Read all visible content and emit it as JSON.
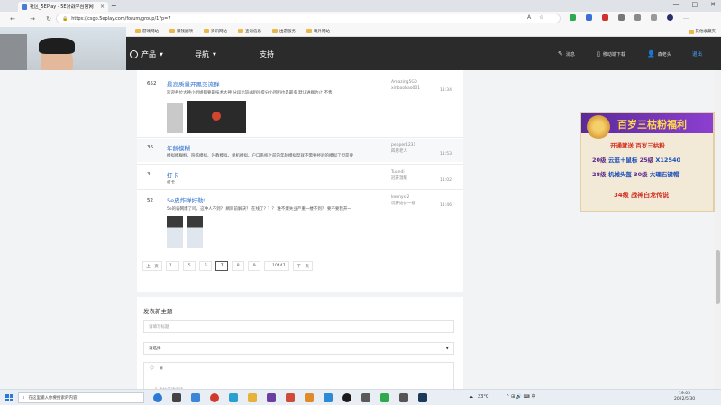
{
  "browser": {
    "tab_title": "社区_5EPlay - 5E对战平台官网",
    "url": "https://csgo.5eplay.com/forum/group/1?p=7",
    "bookmarks": [
      "游戏网站",
      "赚钱副项",
      "资讯网站",
      "查询信息",
      "出游服务",
      "境外网站"
    ],
    "other_bookmarks": "其他收藏夹"
  },
  "site_nav": {
    "products": "产品",
    "nav": "导航",
    "support": "支持",
    "messages": "消息",
    "mobile_download": "移动端下载",
    "username": "森老头",
    "login": "退出"
  },
  "posts": [
    {
      "count": "652",
      "title": "最高质量开黑交流群",
      "subtitle": "欢迎各位大神小姐姐都要最技术大神 分段比较s级别 提分小团团也是最多 默认进群为止 不售",
      "author": "Amazing5G0",
      "author2": "xinbaobao001",
      "time": "11:34"
    },
    {
      "count": "36",
      "title": "年龄模糊",
      "subtitle": "模拟模糊框、陪练模拟、外教模拟、单机模拟、户口系统之前的年龄模拟型就不需要经验的模拟了但是要",
      "author": "pepper1231",
      "author2": "四月老人",
      "time": "11:53"
    },
    {
      "count": "3",
      "title": "打卡",
      "subtitle": "打卡",
      "author": "Tuandi",
      "author2": "冠开温暖",
      "time": "11:02"
    },
    {
      "count": "52",
      "title": "5e皮炸弹好勒!",
      "subtitle": "5e的弱网爆了吗，这种人不到？ 網目前解决？ 在线了？？？ 难不爆失业严重一楼不到？ 要不要我开一",
      "author": "kennys-2",
      "author2": "玩开始价一楼",
      "time": "11:46"
    }
  ],
  "pager": [
    "上一页",
    "1...",
    "5",
    "6",
    "7",
    "8",
    "9",
    "...10447",
    "下一页"
  ],
  "pager_active": "7",
  "new_topic": {
    "title": "发表新主题",
    "title_placeholder": "请填写标题",
    "select_value": "请选择",
    "editor_placeholder": "5 发帖前请阅读"
  },
  "ad": {
    "headline": "百岁三枯粉福利",
    "line1": "开通就送 百岁三枯粉",
    "row1a": "20级",
    "row1b": "云逛＋鼠标",
    "row1c": "25级",
    "row1d": "X12540",
    "row2a": "28级",
    "row2b": "机械头盔",
    "row2c": "30级",
    "row2d": "大理石键帽",
    "row3": "34级 战神白龙传说"
  },
  "taskbar": {
    "search_placeholder": "在这里输入你要搜索的内容",
    "weather": "23°C",
    "time": "19:05",
    "date": "2022/5/30"
  }
}
